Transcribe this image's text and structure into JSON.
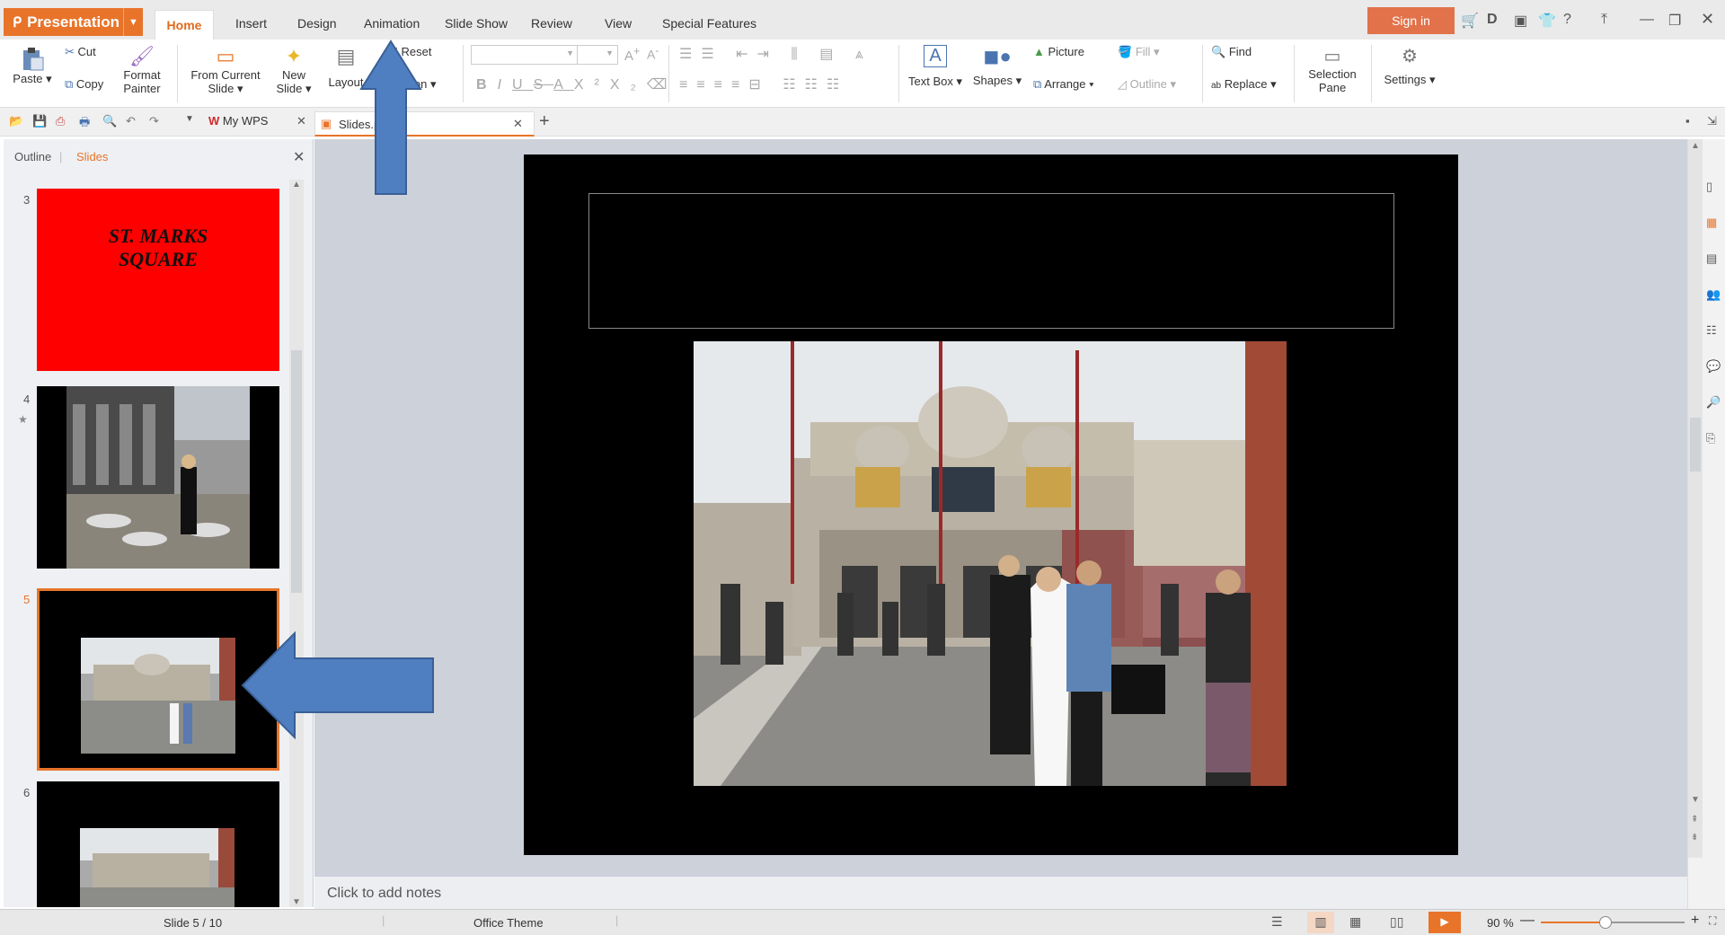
{
  "app": {
    "menu_label": "Presentation"
  },
  "tabs": [
    "Home",
    "Insert",
    "Design",
    "Animation",
    "Slide Show",
    "Review",
    "View",
    "Special Features"
  ],
  "header": {
    "sign_in": "Sign in",
    "help": "?"
  },
  "ribbon": {
    "paste": "Paste",
    "cut": "Cut",
    "copy": "Copy",
    "format_painter_1": "Format",
    "format_painter_2": "Painter",
    "from_current_1": "From Current",
    "from_current_2": "Slide",
    "new_slide_1": "New",
    "new_slide_2": "Slide",
    "layout": "Layout",
    "reset": "Reset",
    "section": "Section",
    "text_box": "Text Box",
    "shapes": "Shapes",
    "picture": "Picture",
    "fill": "Fill",
    "arrange": "Arrange",
    "outline": "Outline",
    "find": "Find",
    "replace": "Replace",
    "selection_1": "Selection",
    "selection_2": "Pane",
    "settings": "Settings",
    "font_name": "",
    "font_size": ""
  },
  "doc_tabs": [
    {
      "label": "My WPS"
    },
    {
      "label": "Slides.pptx"
    }
  ],
  "panel": {
    "outline_tab": "Outline",
    "slides_tab": "Slides"
  },
  "slides": [
    {
      "num": "3",
      "title_line1": "ST. MARKS",
      "title_line2": "SQUARE"
    },
    {
      "num": "4"
    },
    {
      "num": "5"
    },
    {
      "num": "6"
    }
  ],
  "notes_placeholder": "Click to add notes",
  "status": {
    "slide": "Slide 5 / 10",
    "theme": "Office Theme",
    "zoom": "90 %",
    "zoom_level": 0.45
  },
  "colors": {
    "accent": "#e8742a",
    "arrow": "#4f7fc0"
  }
}
